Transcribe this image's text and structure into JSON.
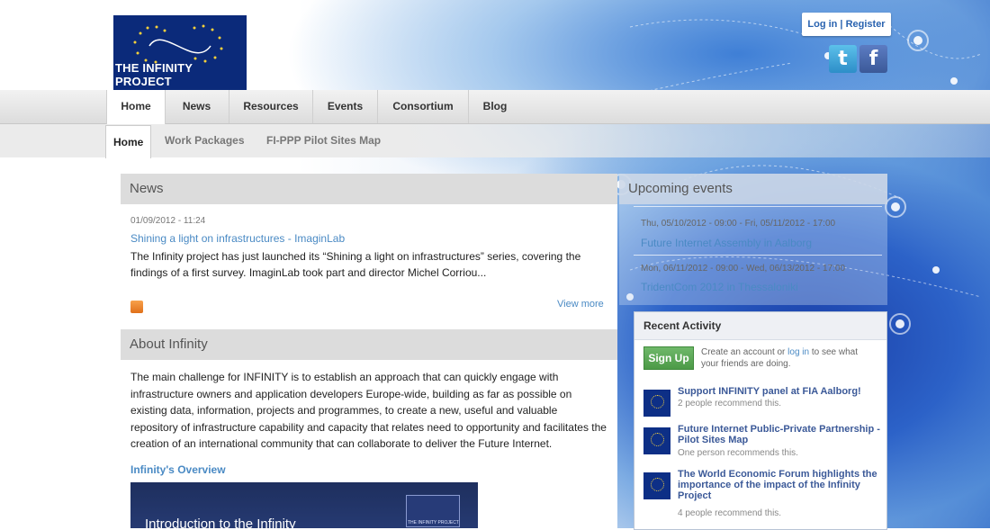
{
  "header": {
    "logo_text": "THE INFINITY PROJECT",
    "login_register": "Log in | Register",
    "twitter_glyph": "t",
    "facebook_glyph": "f"
  },
  "nav": {
    "primary": [
      "Home",
      "News",
      "Resources",
      "Events",
      "Consortium",
      "Blog"
    ],
    "secondary": [
      "Home",
      "Work Packages",
      "FI-PPP Pilot Sites Map"
    ]
  },
  "news": {
    "heading": "News",
    "date": "01/09/2012 - 11:24",
    "title": "Shining a light on infrastructures - ImaginLab",
    "body": "The Infinity project has just launched its “Shining a light on infrastructures” series, covering the findings of a first survey. ImaginLab took part and director Michel Corriou...",
    "view_more": "View more"
  },
  "about": {
    "heading": "About Infinity",
    "body": "The main challenge for INFINITY is to establish an approach that can quickly engage with infrastructure owners and application developers Europe-wide, building as far as possible on existing data, information, projects and programmes, to create a new, useful and valuable repository of infrastructure capability and capacity that relates need to opportunity and facilitates the creation of an international community that can collaborate to deliver the Future Internet.",
    "overview_link": "Infinity's Overview",
    "video_title": "Introduction to the Infinity",
    "video_logo_text": "THE INFINITY PROJECT"
  },
  "events": {
    "heading": "Upcoming events",
    "items": [
      {
        "date": "Thu, 05/10/2012 - 09:00 - Fri, 05/11/2012 - 17:00",
        "title": "Future Internet Assembly in Aalborg"
      },
      {
        "date": "Mon, 06/11/2012 - 09:00 - Wed, 06/13/2012 - 17:00",
        "title": "TridentCom 2012 in Thessaloniki"
      }
    ]
  },
  "activity": {
    "heading": "Recent Activity",
    "signup_label": "Sign Up",
    "signup_text_pre": "Create an account or ",
    "signup_login": "log in",
    "signup_text_post": " to see what your friends are doing.",
    "items": [
      {
        "title": "Support INFINITY panel at FIA Aalborg!",
        "sub": "2 people recommend this."
      },
      {
        "title": "Future Internet Public-Private Partnership - Pilot Sites Map",
        "sub": "One person recommends this."
      },
      {
        "title": "The World Economic Forum highlights the importance of the impact of the Infinity Project",
        "sub": "4 people recommend this."
      }
    ]
  },
  "colors": {
    "link": "#4a8ac4",
    "signup_green": "#4c9a47",
    "map_blue": "#2c62c8"
  }
}
